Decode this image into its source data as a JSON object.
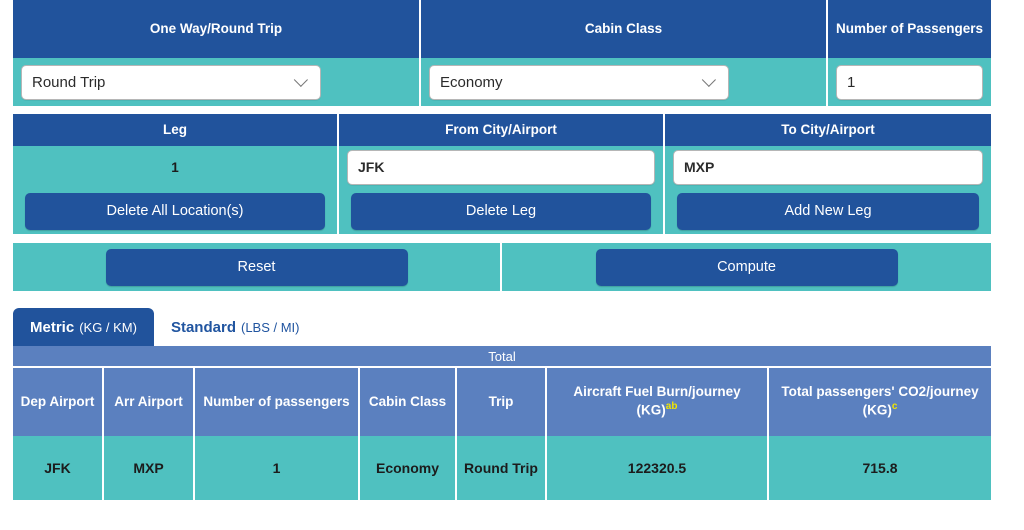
{
  "trip_options": {
    "headers": [
      "One Way/Round Trip",
      "Cabin Class",
      "Number of Passengers"
    ],
    "trip_type": {
      "value": "Round Trip",
      "icon": "chevron-down-icon"
    },
    "cabin_class": {
      "value": "Economy",
      "icon": "chevron-down-icon"
    },
    "passengers": {
      "value": "1",
      "placeholder": "1"
    }
  },
  "legs": {
    "headers": [
      "Leg",
      "From City/Airport",
      "To City/Airport"
    ],
    "rows": [
      {
        "number": "1",
        "from": "JFK",
        "to": "MXP"
      }
    ],
    "buttons": {
      "delete_all": "Delete All Location(s)",
      "delete_leg": "Delete Leg",
      "add_leg": "Add New Leg"
    }
  },
  "actions": {
    "reset": "Reset",
    "compute": "Compute"
  },
  "tabs": [
    {
      "label": "Metric",
      "units": "(KG / KM)",
      "active": true
    },
    {
      "label": "Standard",
      "units": "(LBS / MI)",
      "active": false
    }
  ],
  "results": {
    "group_header": "Total",
    "columns": [
      "Dep Airport",
      "Arr Airport",
      "Number of passengers",
      "Cabin Class",
      "Trip",
      "Aircraft Fuel Burn/journey (KG)",
      "Total passengers' CO2/journey (KG)"
    ],
    "column_notes": [
      "",
      "",
      "",
      "",
      "",
      "ab",
      "c"
    ],
    "rows": [
      {
        "dep_airport": "JFK",
        "arr_airport": "MXP",
        "passengers": "1",
        "cabin_class": "Economy",
        "trip": "Round Trip",
        "fuel_burn": "122320.5",
        "co2": "715.8"
      }
    ]
  },
  "colors": {
    "header_blue": "#21539c",
    "teal": "#4fc1c0",
    "table_header_blue": "#5b80bf",
    "note_yellow": "#f2e500"
  }
}
